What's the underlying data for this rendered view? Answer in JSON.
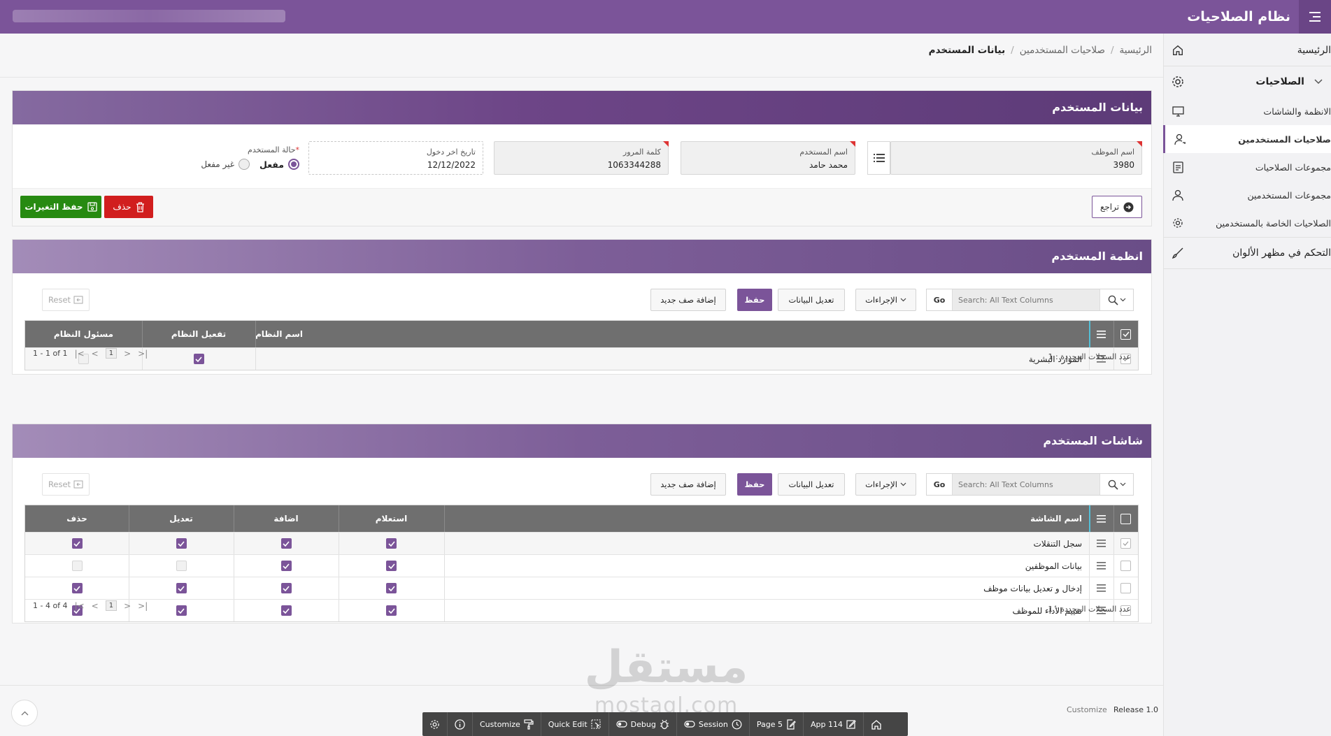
{
  "header": {
    "app_title": "نظام الصلاحيات"
  },
  "sidebar": {
    "home": "الرئيسية",
    "permissions": "الصلاحيات",
    "items": [
      {
        "label": "الانظمة والشاشات",
        "icon": "monitor-icon"
      },
      {
        "label": "صلاحيات المستخدمين",
        "icon": "user-key-icon"
      },
      {
        "label": "مجموعات الصلاحيات",
        "icon": "document-list-icon"
      },
      {
        "label": "مجموعات المستخدمين",
        "icon": "users-icon"
      },
      {
        "label": "الصلاحيات الخاصة بالمستخدمين",
        "icon": "gear-icon"
      }
    ],
    "theme": "التحكم في مظهر الألوان"
  },
  "breadcrumb": {
    "home": "الرئيسية",
    "parent": "صلاحيات المستخدمين",
    "current": "بيانات المستخدم"
  },
  "user_region": {
    "title": "بيانات المستخدم",
    "employee": {
      "label": "اسم الموظف",
      "value": "3980"
    },
    "username": {
      "label": "اسم المستخدم",
      "value": "محمد حامد"
    },
    "password": {
      "label": "كلمة المرور",
      "value": "1063344288"
    },
    "last_login": {
      "label": "تاريخ اخر دخول",
      "value": "12/12/2022"
    },
    "status": {
      "label": "حالة المستخدم",
      "required": "*",
      "active": "مفعل",
      "inactive": "غير مفعل"
    },
    "buttons": {
      "back": "تراجع",
      "delete": "حذف",
      "save": "حفظ التغيرات"
    }
  },
  "toolbar": {
    "search_placeholder": "Search: All Text Columns",
    "go": "Go",
    "actions": "الإجراءات",
    "edit": "تعديل البيانات",
    "save": "حفظ",
    "add_row": "إضافة صف جديد",
    "reset": "Reset"
  },
  "systems_region": {
    "title": "انظمة المستخدم",
    "columns": {
      "name": "اسم النظام",
      "activate": "تفعيل النظام",
      "admin": "مسئول النظام"
    },
    "rows": [
      {
        "name": "الموارد البشرية",
        "activate": true,
        "admin": false
      }
    ],
    "selected": "عدد السجلات المحددة : 1",
    "page": "1",
    "range": "1 - 1 of 1"
  },
  "screens_region": {
    "title": "شاشات المستخدم",
    "columns": {
      "name": "اسم الشاشة",
      "query": "استعلام",
      "add": "اضافة",
      "edit": "تعديل",
      "delete": "حذف"
    },
    "rows": [
      {
        "name": "سجل التنقلات",
        "query": true,
        "add": true,
        "edit": true,
        "delete": true
      },
      {
        "name": "بيانات الموظفين",
        "query": true,
        "add": true,
        "edit": false,
        "delete": false
      },
      {
        "name": "إدخال و تعديل بيانات موظف",
        "query": true,
        "add": true,
        "edit": true,
        "delete": true
      },
      {
        "name": "تقييم الأداء للموظف",
        "query": true,
        "add": true,
        "edit": true,
        "delete": true
      }
    ],
    "selected": "عدد السجلات المحددة : 1",
    "page": "1",
    "range": "1 - 4 of 4"
  },
  "footer": {
    "release": "Release 1.0",
    "customize": "Customize"
  },
  "devbar": {
    "customize": "Customize",
    "quick_edit": "Quick Edit",
    "debug": "Debug",
    "session": "Session",
    "page": "Page 5",
    "app": "App 114"
  },
  "watermark": {
    "line1": "مستقل",
    "line2": "mostaql.com"
  },
  "colors": {
    "primary": "#7b5499",
    "save": "#278a11",
    "delete": "#d11e1e",
    "grid_header": "#6f6f6f"
  }
}
